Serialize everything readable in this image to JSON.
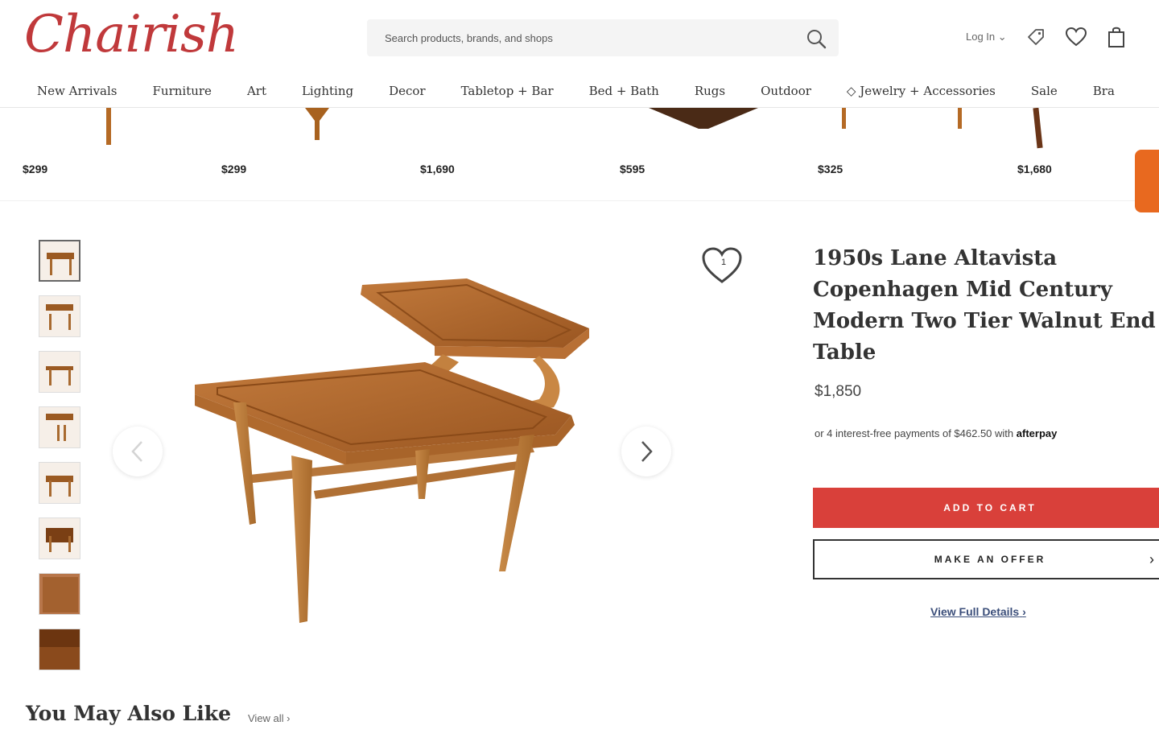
{
  "header": {
    "logo": "Chairish",
    "search_placeholder": "Search products, brands, and shops",
    "login_label": "Log In",
    "login_caret": "⌄"
  },
  "nav": {
    "items": [
      "New Arrivals",
      "Furniture",
      "Art",
      "Lighting",
      "Decor",
      "Tabletop + Bar",
      "Bed + Bath",
      "Rugs",
      "Outdoor",
      "◇ Jewelry + Accessories",
      "Sale",
      "Bra"
    ]
  },
  "recent_strip": {
    "prices": [
      "$299",
      "$299",
      "$1,690",
      "$595",
      "$325",
      "$1,680"
    ]
  },
  "product": {
    "title": "1950s Lane Altavista Copenhagen Mid Century Modern Two Tier Walnut End Table",
    "price": "$1,850",
    "installments_text": "or 4 interest-free payments of $462.50 with",
    "installments_provider": "afterpay",
    "favorite_count": "1",
    "add_to_cart_label": "ADD TO CART",
    "make_offer_label": "MAKE AN OFFER",
    "offer_chevron": "›",
    "view_details_label": "View Full Details",
    "view_details_chevron": "›",
    "thumbnail_count": 8
  },
  "recommendations": {
    "heading": "You May Also Like",
    "view_all_label": "View all ›"
  },
  "colors": {
    "brand": "#c0393b",
    "cart_button": "#d9403a",
    "link": "#3b4e7a",
    "side_tab": "#e8691f",
    "wood": "#b56a25"
  }
}
